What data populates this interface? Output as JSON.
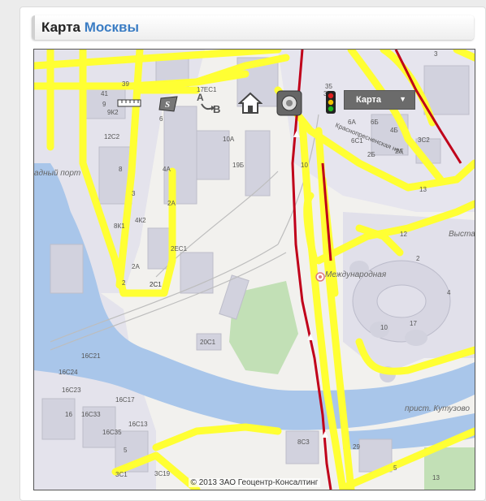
{
  "header": {
    "title_prefix": "Карта",
    "title_city": "Москвы"
  },
  "map": {
    "copyright": "© 2013 ЗАО Геоцентр-Консалтинг",
    "map_type_selector": {
      "selected": "Карта"
    },
    "controls": [
      "ruler-icon",
      "area-measure-icon",
      "route-ab-icon",
      "home-icon",
      "zoom-settings-icon",
      "traffic-light-icon"
    ],
    "place_labels": {
      "port": "адный порт",
      "mezhdunarodnaya": "Международная",
      "prist": "прист. Кутузово",
      "vysta": "Выста",
      "street": "Краснопресненская наб."
    },
    "building_labels": [
      "39",
      "41",
      "9",
      "9К2",
      "12С2",
      "8",
      "6",
      "3",
      "8К1",
      "4К2",
      "2",
      "2А",
      "2С1",
      "4А",
      "2А",
      "2ЕС1",
      "19Б",
      "10А",
      "10",
      "6",
      "6А",
      "6Б",
      "4Б",
      "2А",
      "2Б",
      "6С1",
      "13",
      "12",
      "2",
      "4",
      "10",
      "17",
      "20С1",
      "2С1",
      "16С21",
      "16С24",
      "16С23",
      "16С17",
      "16С33",
      "16С13",
      "16",
      "16С35",
      "3С1",
      "5",
      "3С19",
      "8С3",
      "29",
      "13",
      "5",
      "17ЕС1",
      "35",
      "3",
      "33"
    ],
    "colors": {
      "road_major": "#ffff33",
      "road_jam": "#c0001a",
      "water": "#a9c6ea",
      "park": "#c2e0b6",
      "building": "#dcdce6"
    }
  }
}
